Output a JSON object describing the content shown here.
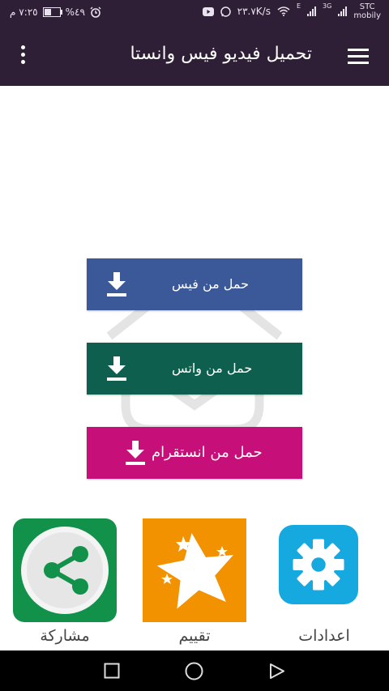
{
  "status_bar": {
    "time": "٧:٢٥ م",
    "battery_percent": "%٤٩",
    "battery_level": 0.49,
    "network_speed": "٢٣.٧K/s",
    "net_type_1": "E",
    "net_type_2": "3G",
    "carrier": "STC",
    "carrier_sub": "mobily"
  },
  "app_bar": {
    "title": "تحميل فيديو فيس وانستا",
    "menu_icon": "hamburger-menu-icon",
    "overflow_icon": "more-vert-icon"
  },
  "download_buttons": {
    "facebook": {
      "label": "حمل من فيس",
      "color": "#3b5998",
      "icon": "download-icon"
    },
    "whatsapp": {
      "label": "حمل من واتس",
      "color": "#0f5f4f",
      "icon": "download-icon"
    },
    "instagram": {
      "label": "حمل من انستقرام",
      "color": "#c60f78",
      "icon": "download-icon"
    }
  },
  "bottom_tiles": {
    "share": {
      "label": "مشاركة",
      "color": "#12914a",
      "icon": "share-icon"
    },
    "rate": {
      "label": "تقييم",
      "color": "#f39200",
      "icon": "star-icon"
    },
    "settings": {
      "label": "اعدادات",
      "color": "#15a9e0",
      "icon": "gear-icon"
    }
  },
  "nav_bar": {
    "recent": "square-recents-icon",
    "home": "circle-home-icon",
    "back": "triangle-back-icon"
  },
  "colors": {
    "app_bar": "#2f1f36",
    "background": "#ffffff"
  }
}
